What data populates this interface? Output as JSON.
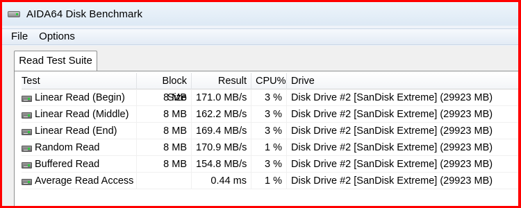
{
  "window": {
    "title": "AIDA64 Disk Benchmark"
  },
  "menu": [
    "File",
    "Options"
  ],
  "tab": {
    "label": "Read Test Suite"
  },
  "table": {
    "headers": {
      "test": "Test",
      "block": "Block Size",
      "result": "Result",
      "cpu": "CPU%",
      "drive": "Drive"
    },
    "rows": [
      {
        "test": "Linear Read (Begin)",
        "block": "8 MB",
        "result": "171.0 MB/s",
        "cpu": "3 %",
        "drive": "Disk Drive #2  [SanDisk Extreme]  (29923 MB)"
      },
      {
        "test": "Linear Read (Middle)",
        "block": "8 MB",
        "result": "162.2 MB/s",
        "cpu": "3 %",
        "drive": "Disk Drive #2  [SanDisk Extreme]  (29923 MB)"
      },
      {
        "test": "Linear Read (End)",
        "block": "8 MB",
        "result": "169.4 MB/s",
        "cpu": "3 %",
        "drive": "Disk Drive #2  [SanDisk Extreme]  (29923 MB)"
      },
      {
        "test": "Random Read",
        "block": "8 MB",
        "result": "170.9 MB/s",
        "cpu": "1 %",
        "drive": "Disk Drive #2  [SanDisk Extreme]  (29923 MB)"
      },
      {
        "test": "Buffered Read",
        "block": "8 MB",
        "result": "154.8 MB/s",
        "cpu": "3 %",
        "drive": "Disk Drive #2  [SanDisk Extreme]  (29923 MB)"
      },
      {
        "test": "Average Read Access",
        "block": "",
        "result": "0.44 ms",
        "cpu": "1 %",
        "drive": "Disk Drive #2  [SanDisk Extreme]  (29923 MB)"
      }
    ]
  },
  "icons": {
    "title": "hard-drive-icon",
    "row": "hard-drive-icon"
  },
  "colors": {
    "frame": "#ff0000",
    "titlebar": "#dde9f5",
    "panel": "#ffffff"
  }
}
